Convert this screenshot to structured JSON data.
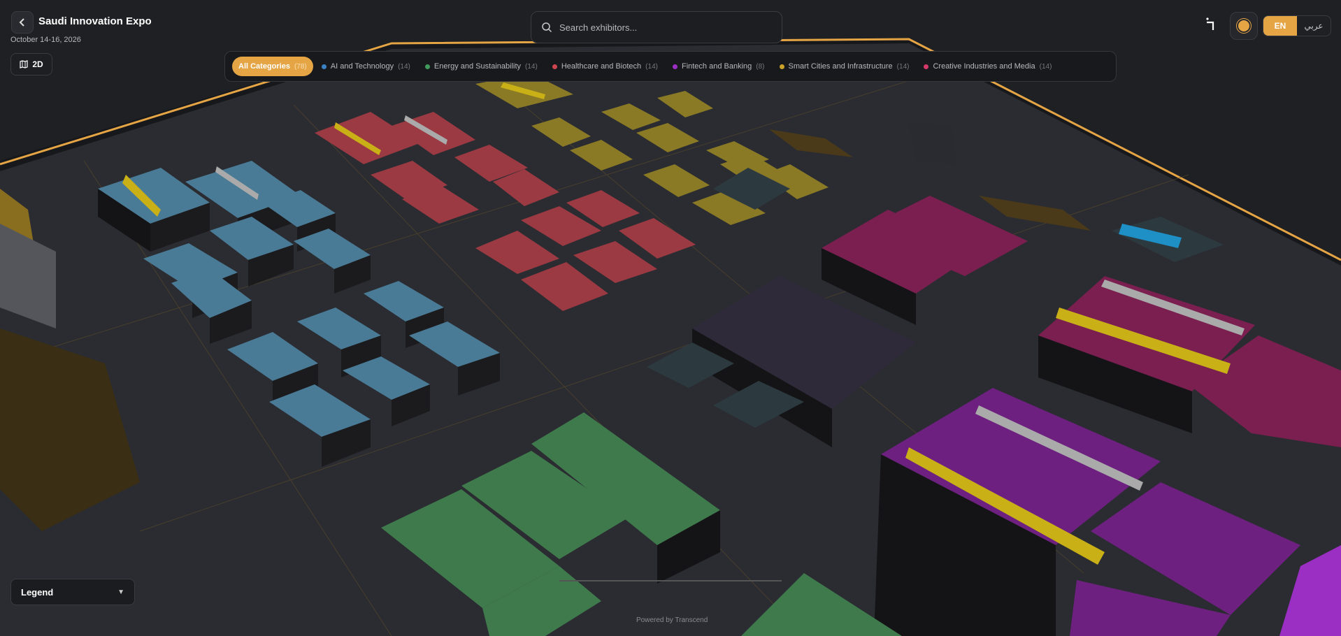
{
  "header": {
    "back_icon": "chevron-left-icon",
    "title": "Saudi Innovation Expo",
    "date": "October 14-16, 2026",
    "view_toggle_label": "2D",
    "view_toggle_icon": "map-icon"
  },
  "search": {
    "placeholder": "Search exhibitors...",
    "value": "",
    "icon": "search-icon"
  },
  "filters": [
    {
      "label": "All Categories",
      "count": "(78)",
      "active": true,
      "color": "#e5a545"
    },
    {
      "label": "AI and Technology",
      "count": "(14)",
      "active": false,
      "color": "#3b82c4"
    },
    {
      "label": "Energy and Sustainability",
      "count": "(14)",
      "active": false,
      "color": "#3f9a5c"
    },
    {
      "label": "Healthcare and Biotech",
      "count": "(14)",
      "active": false,
      "color": "#d0454f"
    },
    {
      "label": "Fintech and Banking",
      "count": "(8)",
      "active": false,
      "color": "#9b2fc4"
    },
    {
      "label": "Smart Cities and Infrastructure",
      "count": "(14)",
      "active": false,
      "color": "#c9a227"
    },
    {
      "label": "Creative Industries and Media",
      "count": "(14)",
      "active": false,
      "color": "#d33a6a"
    }
  ],
  "toolbar": {
    "brand_icon": "transcend-logo-icon",
    "theme_icon": "sun-icon",
    "lang_en": "EN",
    "lang_ar": "عربي",
    "active_lang": "EN"
  },
  "legend": {
    "label": "Legend",
    "icon": "chevron-down-icon"
  },
  "footer": {
    "powered_by": "Powered by Transcend"
  },
  "colors": {
    "accent": "#e5a545",
    "ai": "#4a7b96",
    "energy": "#3f7a4c",
    "health": "#9b3a42",
    "fintech": "#6e2080",
    "smart": "#8a7a25",
    "media": "#7a1f50",
    "floor": "#26272b",
    "wall": "#1a1b1f",
    "wall_trim": "#e5a545"
  }
}
